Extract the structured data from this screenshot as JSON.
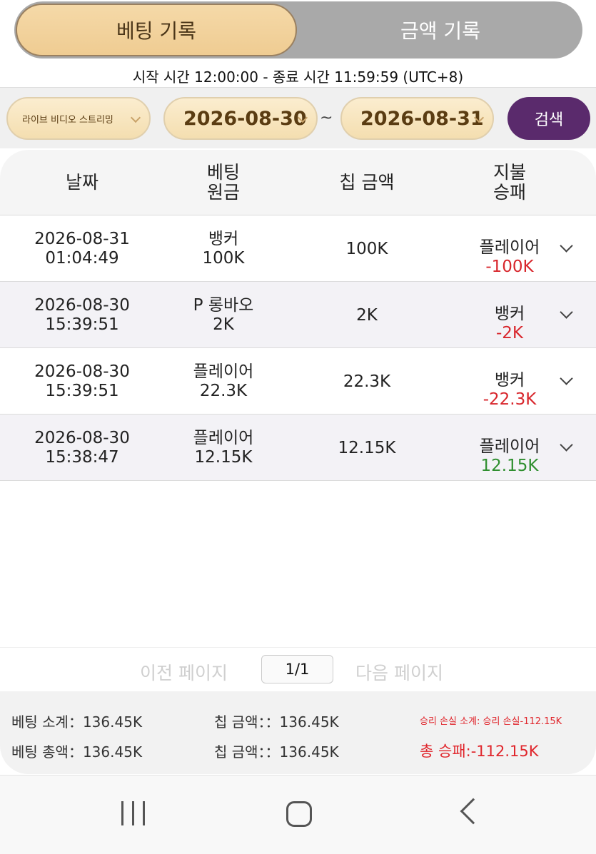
{
  "tabs": [
    {
      "label": "베팅 기록"
    },
    {
      "label": "금액 기록"
    }
  ],
  "time_range": "시작 시간 12:00:00 - 종료 시간 11:59:59 (UTC+8)",
  "filter": {
    "game": "라이브 비디오 스트리밍",
    "start_date": "2026-08-30",
    "separator": "~",
    "end_date": "2026-08-31",
    "search_label": "검색"
  },
  "table": {
    "headers": {
      "date": "날짜",
      "bet_line1": "베팅",
      "bet_line2": "원금",
      "chip": "칩 금액",
      "pay_line1": "지불",
      "pay_line2": "승패"
    },
    "rows": [
      {
        "date": "2026-08-31",
        "time": "01:04:49",
        "bet_type": "뱅커",
        "bet_amount": "100K",
        "chip": "100K",
        "result": "플레이어",
        "winloss": "-100K"
      },
      {
        "date": "2026-08-30",
        "time": "15:39:51",
        "bet_type": "P 롱바오",
        "bet_amount": "2K",
        "chip": "2K",
        "result": "뱅커",
        "winloss": "-2K"
      },
      {
        "date": "2026-08-30",
        "time": "15:39:51",
        "bet_type": "플레이어",
        "bet_amount": "22.3K",
        "chip": "22.3K",
        "result": "뱅커",
        "winloss": "-22.3K"
      },
      {
        "date": "2026-08-30",
        "time": "15:38:47",
        "bet_type": "플레이어",
        "bet_amount": "12.15K",
        "chip": "12.15K",
        "result": "플레이어",
        "winloss": "12.15K"
      }
    ]
  },
  "pager": {
    "prev": "이전 페이지",
    "page": "1/1",
    "next": "다음 페이지"
  },
  "summary": {
    "bet_subtotal": "베팅 소계：136.45K",
    "chip_subtotal": "칩 금액：：136.45K",
    "winloss_subtotal": "승리 손실 소계: 승리 손실-112.15K",
    "bet_total": "베팅 총액：136.45K",
    "chip_total": "칩 금액：：136.45K",
    "winloss_total": "총 승패:-112.15K"
  },
  "colors": {
    "accent_purple": "#5a2a6c",
    "gold_pill": "#f4deb0",
    "loss": "#d8262c",
    "win": "#2f8f2f"
  }
}
